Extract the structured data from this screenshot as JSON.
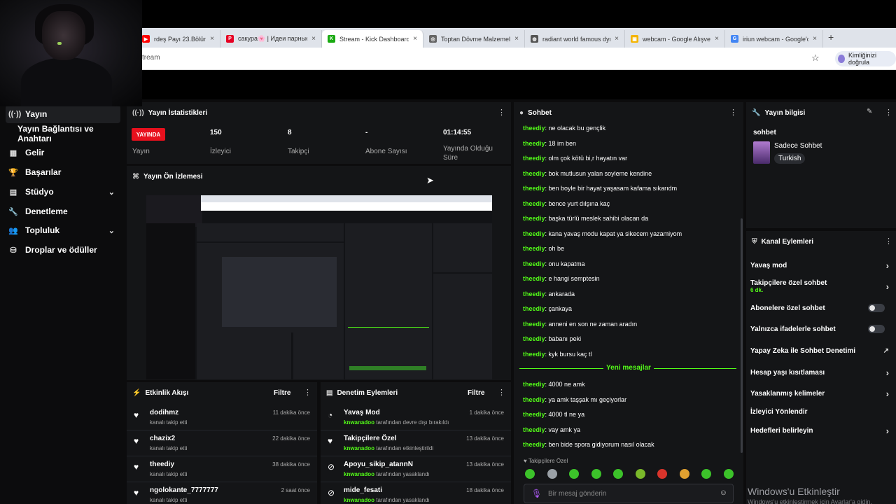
{
  "browser": {
    "tabs": [
      {
        "title": "rdeş Payı 23.Bölüm (Bi...",
        "color": "#ff0000",
        "glyph": "▶"
      },
      {
        "title": "сакура🌸 | Идеи парные...",
        "color": "#e60023",
        "glyph": "P"
      },
      {
        "title": "Stream - Kick Dashboard",
        "color": "#1aaa12",
        "glyph": "K",
        "active": true
      },
      {
        "title": "Toptan Dövme Malzemele...",
        "color": "#666666",
        "glyph": "◎"
      },
      {
        "title": "radiant world famous dyn...",
        "color": "#555555",
        "glyph": "◍"
      },
      {
        "title": "webcam - Google Alışveri...",
        "color": "#f4b400",
        "glyph": "▣"
      },
      {
        "title": "iriun webcam - Google'da...",
        "color": "#4285f4",
        "glyph": "G"
      }
    ],
    "address": "tream",
    "profile_label": "Kimliğinizi doğrula"
  },
  "sidebar": {
    "items": [
      {
        "label": "Yayın",
        "icon": "broadcast-icon",
        "glyph": "((·))",
        "selected": true
      },
      {
        "label": "Yayın Bağlantısı ve Anahtarı",
        "sub": true
      },
      {
        "label": "Gelir",
        "icon": "revenue-icon",
        "glyph": "▦"
      },
      {
        "label": "Başarılar",
        "icon": "trophy-icon",
        "glyph": "🏆"
      },
      {
        "label": "Stüdyo",
        "icon": "studio-icon",
        "glyph": "▤",
        "chevron": true
      },
      {
        "label": "Denetleme",
        "icon": "wrench-icon",
        "glyph": "🔧"
      },
      {
        "label": "Topluluk",
        "icon": "community-icon",
        "glyph": "👥",
        "chevron": true
      },
      {
        "label": "Droplar ve ödüller",
        "icon": "drops-icon",
        "glyph": "⛁"
      }
    ]
  },
  "stats": {
    "title": "Yayın İstatistikleri",
    "live_badge": "YAYINDA",
    "live_label": "Yayın",
    "viewers": "150",
    "viewers_label": "İzleyici",
    "followers": "8",
    "followers_label": "Takipçi",
    "subs": "-",
    "subs_label": "Abone Sayısı",
    "uptime": "01:14:55",
    "uptime_label": "Yayında Olduğu Süre"
  },
  "preview": {
    "title": "Yayın Ön İzlemesi"
  },
  "activity": {
    "title": "Etkinlik Akışı",
    "filter": "Filtre",
    "items": [
      {
        "name": "dodihmz",
        "sub": "kanalı takip etti",
        "time": "11 dakika önce"
      },
      {
        "name": "chazix2",
        "sub": "kanalı takip etti",
        "time": "22 dakika önce"
      },
      {
        "name": "theediy",
        "sub": "kanalı takip etti",
        "time": "38 dakika önce"
      },
      {
        "name": "ngolokante_7777777",
        "sub": "kanalı takip etti",
        "time": "2 saat önce"
      }
    ]
  },
  "moderation": {
    "title": "Denetim Eylemleri",
    "filter": "Filtre",
    "items": [
      {
        "name": "Yavaş Mod",
        "user": "knwanadoo",
        "sub": " tarafından devre dışı bırakıldı",
        "time": "1 dakika önce",
        "icon": "slow-mode-icon",
        "glyph": "◔"
      },
      {
        "name": "Takipçilere Özel",
        "user": "knwanadoo",
        "sub": " tarafından etkinleştirildi",
        "time": "13 dakika önce",
        "icon": "heart-icon",
        "glyph": "♥"
      },
      {
        "name": "Apoyu_sikip_atannN",
        "user": "knwanadoo",
        "sub": " tarafından yasaklandı",
        "time": "13 dakika önce",
        "icon": "ban-icon",
        "glyph": "⊘"
      },
      {
        "name": "mide_fesati",
        "user": "knwanadoo",
        "sub": " tarafından yasaklandı",
        "time": "18 dakika önce",
        "icon": "ban-icon",
        "glyph": "⊘"
      }
    ]
  },
  "chat": {
    "title": "Sohbet",
    "messages_top": [
      {
        "user": "theediy",
        "text": "ne olacak bu gençlik"
      },
      {
        "user": "theediy",
        "text": "18 im ben"
      },
      {
        "user": "theediy",
        "text": "olm çok kötü bi,r hayatın var"
      },
      {
        "user": "theediy",
        "text": "bok mutlusun yalan soyleme kendine"
      },
      {
        "user": "theediy",
        "text": "ben boyle bir hayat yaşasam kafama sıkarıdm"
      },
      {
        "user": "theediy",
        "text": "bence yurt dılşına kaç"
      },
      {
        "user": "theediy",
        "text": "başka türlü meslek sahibi olacan da"
      },
      {
        "user": "theediy",
        "text": "kana yavaş modu kapat ya sikecem yazamiyom"
      },
      {
        "user": "theediy",
        "text": "oh be"
      },
      {
        "user": "theediy",
        "text": "onu kapatma"
      },
      {
        "user": "theediy",
        "text": "e hangi semptesin"
      },
      {
        "user": "theediy",
        "text": "ankarada"
      },
      {
        "user": "theediy",
        "text": "çankaya"
      },
      {
        "user": "theediy",
        "text": "anneni en son ne zaman aradın"
      },
      {
        "user": "theediy",
        "text": "babanı peki"
      },
      {
        "user": "theediy",
        "text": "kyk bursu kaç tl"
      }
    ],
    "new_messages_label": "Yeni mesajlar",
    "messages_bottom": [
      {
        "user": "theediy",
        "text": "4000 ne amk"
      },
      {
        "user": "theediy",
        "text": "ya amk taşşak mı geçiyorlar"
      },
      {
        "user": "theediy",
        "text": "4000 tl ne ya"
      },
      {
        "user": "theediy",
        "text": "vay amk ya"
      },
      {
        "user": "theediy",
        "text": "ben bide spora gidiyorum nasıl olacak"
      }
    ],
    "followers_only_label": "Takipçilere Özel",
    "placeholder": "Bir mesaj gönderin"
  },
  "stream_info": {
    "title": "Yayın bilgisi",
    "stream_title": "sohbet",
    "category": "Sadece Sohbet",
    "tag": "Turkish"
  },
  "channel_actions": {
    "title": "Kanal Eylemleri",
    "items": [
      {
        "label": "Yavaş mod",
        "kind": "arrow"
      },
      {
        "label": "Takipçilere özel sohbet",
        "note": "6 dk.",
        "kind": "arrow"
      },
      {
        "label": "Abonelere özel sohbet",
        "kind": "toggle"
      },
      {
        "label": "Yalnızca ifadelerle sohbet",
        "kind": "toggle"
      },
      {
        "label": "Yapay Zeka ile Sohbet Denetimi",
        "kind": "external"
      },
      {
        "label": "Hesap yaşı kısıtlaması",
        "kind": "arrow"
      },
      {
        "label": "Yasaklanmış kelimeler",
        "kind": "arrow"
      },
      {
        "label": "İzleyici Yönlendir",
        "kind": "none"
      },
      {
        "label": "Hedefleri belirleyin",
        "kind": "arrow"
      }
    ]
  },
  "watermark": {
    "line1": "Windows'u Etkinleştir",
    "line2": "Windows'u etkinleştirmek için Ayarlar'a gidin."
  },
  "colors": {
    "accent": "#53fc18",
    "live": "#e8101d",
    "panel": "#141517"
  }
}
